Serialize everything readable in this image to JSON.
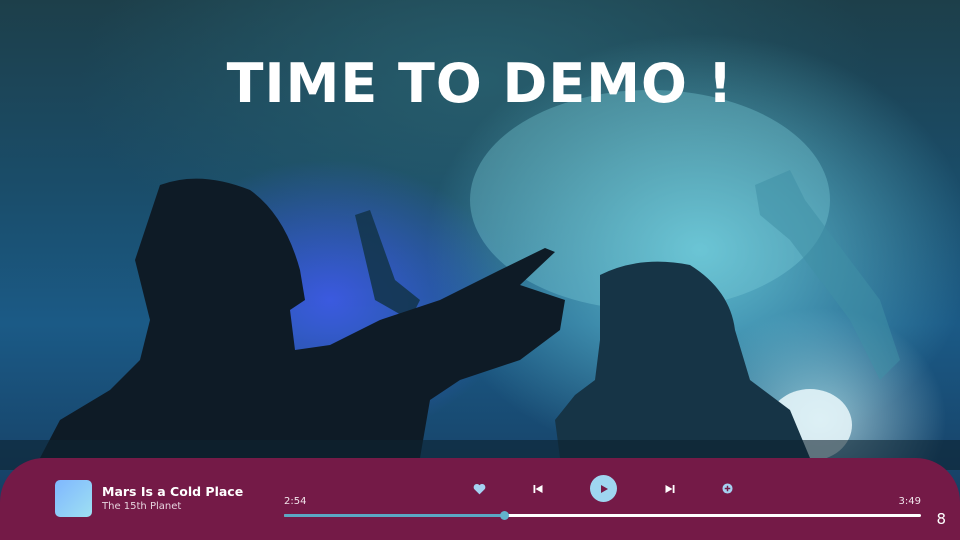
{
  "slide": {
    "title": "TIME TO DEMO !",
    "page_number": "8"
  },
  "player": {
    "track_title": "Mars Is a Cold Place",
    "track_artist": "The 15th Planet",
    "elapsed": "2:54",
    "total": "3:49",
    "progress_percent": 34.6,
    "accent_color": "#741a47",
    "progress_color": "#5aa8c4",
    "controls": {
      "like_icon": "heart-icon",
      "prev_icon": "skip-back-icon",
      "play_icon": "play-icon",
      "next_icon": "skip-forward-icon",
      "add_icon": "plus-circle-icon"
    }
  }
}
